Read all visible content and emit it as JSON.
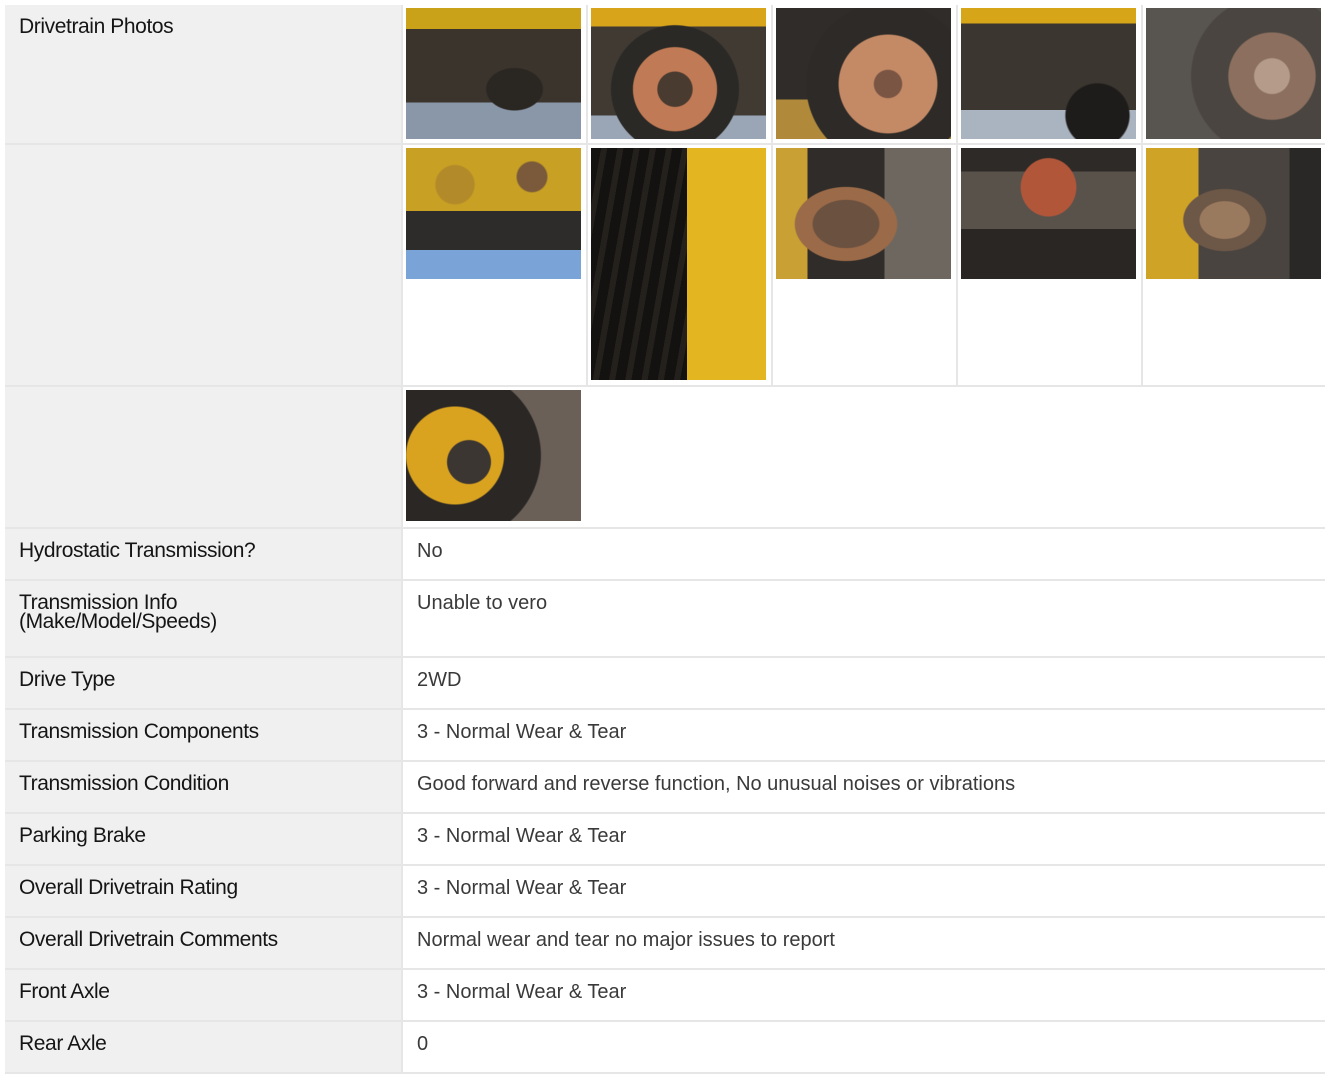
{
  "drivetrain_photos": {
    "label": "Drivetrain Photos",
    "rows": [
      [
        {
          "icon": "photo-underside"
        },
        {
          "icon": "photo-wheel-axle"
        },
        {
          "icon": "photo-brake-rotor"
        },
        {
          "icon": "photo-chassis"
        },
        {
          "icon": "photo-hub"
        }
      ],
      [
        {
          "icon": "photo-tank-underside"
        },
        {
          "icon": "photo-hoses"
        },
        {
          "icon": "photo-drive-joint"
        },
        {
          "icon": "photo-rusted-joint"
        },
        {
          "icon": "photo-tire-joint"
        }
      ],
      [
        {
          "icon": "photo-yoke"
        }
      ]
    ]
  },
  "details": [
    {
      "label": "Hydrostatic Transmission?",
      "value": "No"
    },
    {
      "label": "Transmission Info\n(Make/Model/Speeds)",
      "value": "Unable to vero"
    },
    {
      "label": "Drive Type",
      "value": "2WD"
    },
    {
      "label": "Transmission Components",
      "value": "3 - Normal Wear & Tear"
    },
    {
      "label": "Transmission Condition",
      "value": "Good forward and reverse function, No unusual noises or vibrations"
    },
    {
      "label": "Parking Brake",
      "value": "3 - Normal Wear & Tear"
    },
    {
      "label": "Overall Drivetrain Rating",
      "value": "3 - Normal Wear & Tear"
    },
    {
      "label": "Overall Drivetrain Comments",
      "value": "Normal wear and tear no major issues to report"
    },
    {
      "label": "Front Axle",
      "value": "3 - Normal Wear & Tear"
    },
    {
      "label": "Rear Axle",
      "value": "0"
    }
  ]
}
